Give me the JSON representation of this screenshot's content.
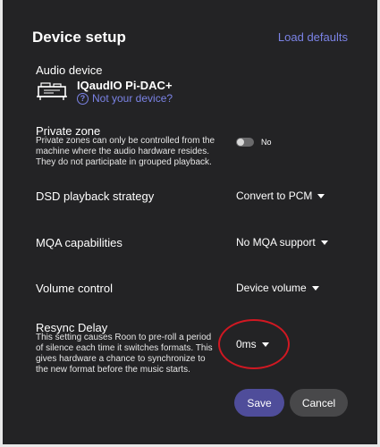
{
  "header": {
    "title": "Device setup",
    "load_defaults": "Load defaults"
  },
  "audio_device": {
    "label": "Audio device",
    "name": "IQaudIO Pi-DAC+",
    "not_your_device": "Not your device?",
    "help_glyph": "?",
    "icon": "dac-board-icon"
  },
  "private_zone": {
    "label": "Private zone",
    "description": "Private zones can only be controlled from the machine where the audio hardware resides. They do not participate in grouped playback.",
    "toggle_value": "No"
  },
  "dsd_strategy": {
    "label": "DSD playback strategy",
    "value": "Convert to PCM"
  },
  "mqa": {
    "label": "MQA capabilities",
    "value": "No MQA support"
  },
  "volume": {
    "label": "Volume control",
    "value": "Device volume"
  },
  "resync": {
    "label": "Resync Delay",
    "description": "This setting causes Roon to pre-roll a period of silence each time it switches formats. This gives hardware a chance to synchronize to the new format before the music starts.",
    "value": "0ms"
  },
  "buttons": {
    "save": "Save",
    "cancel": "Cancel"
  },
  "colors": {
    "background": "#232325",
    "accent": "#7b83e6",
    "save_button": "#4f4d9a",
    "cancel_button": "#48484a",
    "annotation_circle": "#d01822"
  }
}
